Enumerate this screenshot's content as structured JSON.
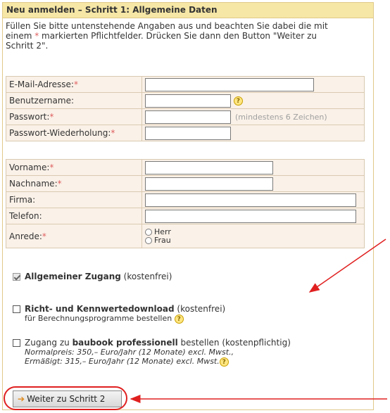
{
  "header": {
    "title": "Neu anmelden – Schritt 1: Allgemeine Daten"
  },
  "intro": {
    "line1": "Füllen Sie bitte untenstehende Angaben aus und beachten Sie dabei die mit",
    "line2_pre": "einem ",
    "star": "*",
    "line2_post": " markierten Pflichtfelder. Drücken Sie dann den Button \"Weiter zu",
    "line3": "Schritt 2\"."
  },
  "account_fields": {
    "email_label": "E-Mail-Adresse:",
    "username_label": "Benutzername:",
    "password_label": "Passwort:",
    "password_hint": "(mindestens 6 Zeichen)",
    "password_repeat_label": "Passwort-Wiederholung:"
  },
  "personal_fields": {
    "firstname_label": "Vorname:",
    "lastname_label": "Nachname:",
    "company_label": "Firma:",
    "phone_label": "Telefon:",
    "salutation_label": "Anrede:",
    "salutation_options": [
      "Herr",
      "Frau"
    ]
  },
  "required_marker": "*",
  "help_glyph": "?",
  "options": {
    "general_bold": "Allgemeiner Zugang",
    "general_rest": " (kostenfrei)",
    "download_bold": "Richt- und Kennwertedownload",
    "download_rest": " (kostenfrei)",
    "download_sub": "für Berechnungsprogramme bestellen",
    "pro_pre": "Zugang zu ",
    "pro_bold": "baubook professionell",
    "pro_rest": " bestellen (kostenpflichtig)",
    "pro_price1": "Normalpreis: 350,– Euro/Jahr (12 Monate) excl. Mwst.,",
    "pro_price2": "Ermäßigt: 315,– Euro/Jahr (12 Monate) excl. Mwst."
  },
  "submit": {
    "label": "Weiter zu Schritt 2",
    "arrow": "➔"
  },
  "colors": {
    "header_bg": "#f6e7a6",
    "form_bg": "#faf1e8",
    "required": "#e06060",
    "annotation": "#e02020"
  }
}
